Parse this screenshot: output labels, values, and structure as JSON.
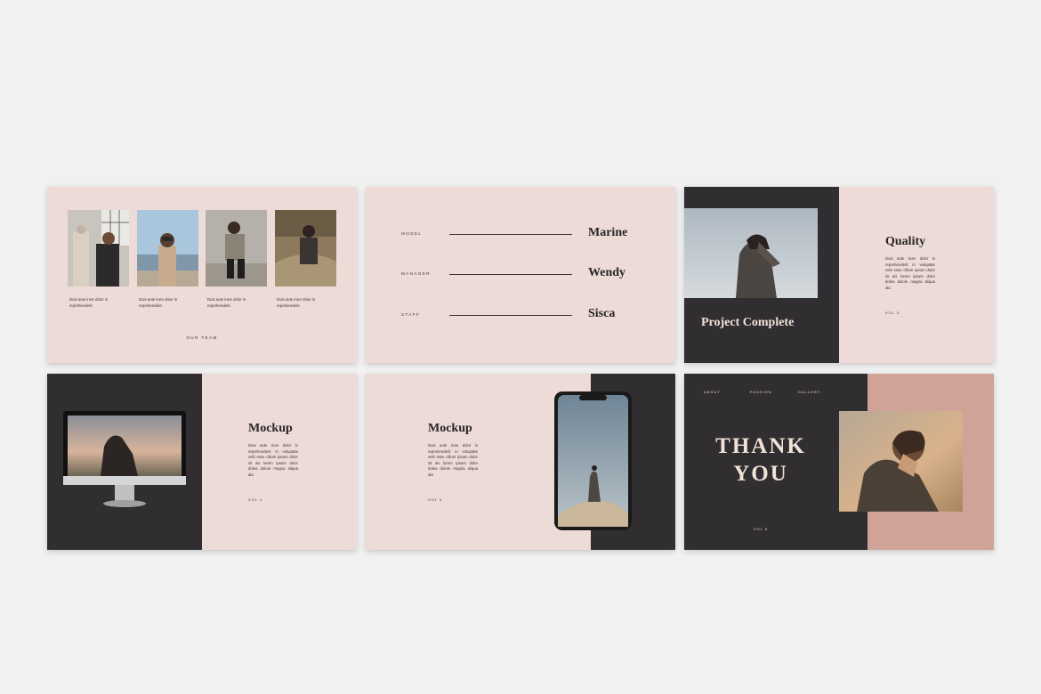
{
  "slide1": {
    "captions": [
      "Duis aute irure dolor in reprehenderit.",
      "Duis aute irure dolor in reprehenderit.",
      "Duis aute irure dolor in reprehenderit.",
      "Duis aute irure dolor in reprehenderit."
    ],
    "footer": "OUR TEAM"
  },
  "slide2": {
    "rows": [
      {
        "role": "MODEL",
        "name": "Marine"
      },
      {
        "role": "MANAGER",
        "name": "Wendy"
      },
      {
        "role": "STAFF",
        "name": "Sisca"
      }
    ]
  },
  "slide3": {
    "heading": "Project Complete",
    "title": "Quality",
    "body": "Duis aute irure dolor in reprehenderit in voluptate velit esse cillum ipsum dolor sit ais lorem ipsum dolor dolea dolore magna aliqua ala",
    "vol": "VOL 3"
  },
  "slide4": {
    "title": "Mockup",
    "body": "Duis aute irure dolor in reprehenderit in voluptate velit esse cillum ipsum dolor sit ais lorem ipsum dolor dolea dolore magna aliqua ala",
    "vol": "VOL 4"
  },
  "slide5": {
    "title": "Mockup",
    "body": "Duis aute irure dolor in reprehenderit in voluptate velit esse cillum ipsum dolor sit ais lorem ipsum dolor dolea dolore magna aliqua ala",
    "vol": "VOL 5"
  },
  "slide6": {
    "nav": [
      "ABOUT",
      "FASHION",
      "GALLERY"
    ],
    "line1": "THANK",
    "line2": "YOU",
    "vol": "VOL 6"
  },
  "colors": {
    "pink": "#ecdbd7",
    "dark": "#302e31",
    "rose": "#cfa397",
    "cream": "#f1e2d8"
  }
}
